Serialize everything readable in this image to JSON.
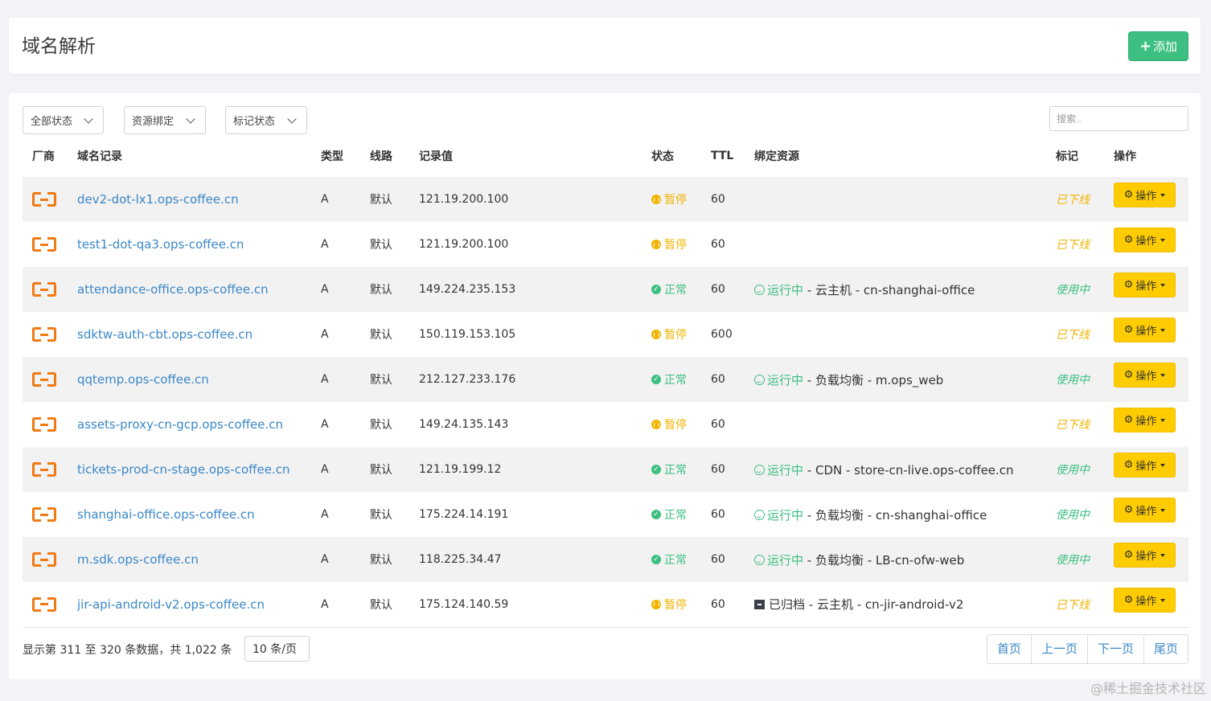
{
  "header": {
    "title": "域名解析",
    "add_label": "添加"
  },
  "filters": [
    {
      "label": "全部状态"
    },
    {
      "label": "资源绑定"
    },
    {
      "label": "标记状态"
    }
  ],
  "search": {
    "placeholder": "搜索.."
  },
  "columns": [
    "厂商",
    "域名记录",
    "类型",
    "线路",
    "记录值",
    "状态",
    "TTL",
    "绑定资源",
    "标记",
    "操作"
  ],
  "rows": [
    {
      "domain": "dev2-dot-lx1.ops-coffee.cn",
      "type": "A",
      "line": "默认",
      "value": "121.19.200.100",
      "status": "暂停",
      "status_kind": "paused",
      "ttl": "60",
      "bind_state": "",
      "bind_kind": "none",
      "bind_text": "",
      "mark": "已下线",
      "mark_kind": "offline",
      "op": "操作"
    },
    {
      "domain": "test1-dot-qa3.ops-coffee.cn",
      "type": "A",
      "line": "默认",
      "value": "121.19.200.100",
      "status": "暂停",
      "status_kind": "paused",
      "ttl": "60",
      "bind_state": "",
      "bind_kind": "none",
      "bind_text": "",
      "mark": "已下线",
      "mark_kind": "offline",
      "op": "操作"
    },
    {
      "domain": "attendance-office.ops-coffee.cn",
      "type": "A",
      "line": "默认",
      "value": "149.224.235.153",
      "status": "正常",
      "status_kind": "normal",
      "ttl": "60",
      "bind_state": "运行中",
      "bind_kind": "running",
      "bind_text": " - 云主机 - cn-shanghai-office",
      "mark": "使用中",
      "mark_kind": "inuse",
      "op": "操作"
    },
    {
      "domain": "sdktw-auth-cbt.ops-coffee.cn",
      "type": "A",
      "line": "默认",
      "value": "150.119.153.105",
      "status": "暂停",
      "status_kind": "paused",
      "ttl": "600",
      "bind_state": "",
      "bind_kind": "none",
      "bind_text": "",
      "mark": "已下线",
      "mark_kind": "offline",
      "op": "操作"
    },
    {
      "domain": "qqtemp.ops-coffee.cn",
      "type": "A",
      "line": "默认",
      "value": "212.127.233.176",
      "status": "正常",
      "status_kind": "normal",
      "ttl": "60",
      "bind_state": "运行中",
      "bind_kind": "running",
      "bind_text": " - 负载均衡 - m.ops_web",
      "mark": "使用中",
      "mark_kind": "inuse",
      "op": "操作"
    },
    {
      "domain": "assets-proxy-cn-gcp.ops-coffee.cn",
      "type": "A",
      "line": "默认",
      "value": "149.24.135.143",
      "status": "暂停",
      "status_kind": "paused",
      "ttl": "60",
      "bind_state": "",
      "bind_kind": "none",
      "bind_text": "",
      "mark": "已下线",
      "mark_kind": "offline",
      "op": "操作"
    },
    {
      "domain": "tickets-prod-cn-stage.ops-coffee.cn",
      "type": "A",
      "line": "默认",
      "value": "121.19.199.12",
      "status": "正常",
      "status_kind": "normal",
      "ttl": "60",
      "bind_state": "运行中",
      "bind_kind": "running",
      "bind_text": " - CDN - store-cn-live.ops-coffee.cn",
      "mark": "使用中",
      "mark_kind": "inuse",
      "op": "操作"
    },
    {
      "domain": "shanghai-office.ops-coffee.cn",
      "type": "A",
      "line": "默认",
      "value": "175.224.14.191",
      "status": "正常",
      "status_kind": "normal",
      "ttl": "60",
      "bind_state": "运行中",
      "bind_kind": "running",
      "bind_text": " - 负载均衡 - cn-shanghai-office",
      "mark": "使用中",
      "mark_kind": "inuse",
      "op": "操作"
    },
    {
      "domain": "m.sdk.ops-coffee.cn",
      "type": "A",
      "line": "默认",
      "value": "118.225.34.47",
      "status": "正常",
      "status_kind": "normal",
      "ttl": "60",
      "bind_state": "运行中",
      "bind_kind": "running",
      "bind_text": " - 负载均衡 - LB-cn-ofw-web",
      "mark": "使用中",
      "mark_kind": "inuse",
      "op": "操作"
    },
    {
      "domain": "jir-api-android-v2.ops-coffee.cn",
      "type": "A",
      "line": "默认",
      "value": "175.124.140.59",
      "status": "暂停",
      "status_kind": "paused",
      "ttl": "60",
      "bind_state": "已归档",
      "bind_kind": "archived",
      "bind_text": " - 云主机 - cn-jir-android-v2",
      "mark": "已下线",
      "mark_kind": "offline",
      "op": "操作"
    }
  ],
  "footer": {
    "info": "显示第 311 至 320 条数据，共 1,022 条",
    "page_size": "10 条/页",
    "pager": [
      "首页",
      "上一页",
      "下一页",
      "尾页"
    ]
  },
  "watermark": "@稀土掘金技术社区",
  "colors": {
    "green": "#3dbf82",
    "yellow": "#ffcc00",
    "orange": "#f07a14",
    "link": "#3a87c8"
  }
}
